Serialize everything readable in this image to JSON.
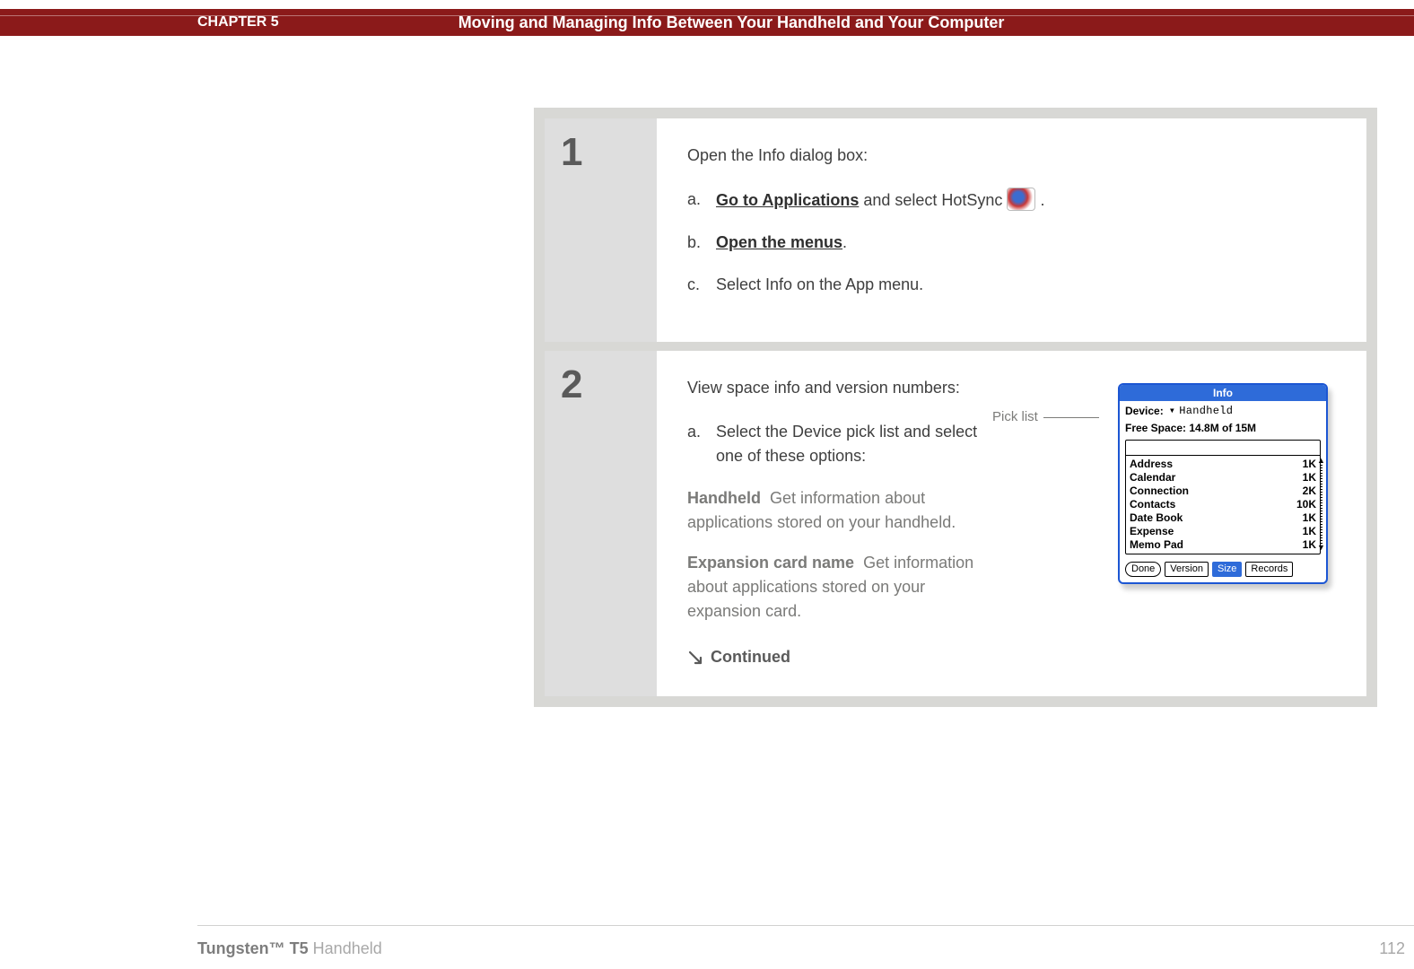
{
  "header": {
    "chapter": "CHAPTER 5",
    "title": "Moving and Managing Info Between Your Handheld and Your Computer"
  },
  "steps": {
    "one": {
      "num": "1",
      "intro": "Open the Info dialog box:",
      "a_link": "Go to Applications",
      "a_rest": " and select HotSync ",
      "a_period": ".",
      "b_link": "Open the menus",
      "b_period": ".",
      "c_text": "Select Info on the App menu."
    },
    "two": {
      "num": "2",
      "intro": "View space info and version numbers:",
      "a_text": "Select the Device pick list and select one of these options:",
      "opt1_name": "Handheld",
      "opt1_desc": "Get information about applications stored on your handheld.",
      "opt2_name": "Expansion card name",
      "opt2_desc": "Get information about applications stored on your expansion card.",
      "continued": "Continued"
    }
  },
  "callout": {
    "picklist": "Pick list"
  },
  "info_dialog": {
    "title": "Info",
    "device_label": "Device:",
    "device_value": "Handheld",
    "free_space": "Free Space: 14.8M of 15M",
    "items": [
      {
        "name": "Address",
        "size": "1K"
      },
      {
        "name": "Calendar",
        "size": "1K"
      },
      {
        "name": "Connection",
        "size": "2K"
      },
      {
        "name": "Contacts",
        "size": "10K"
      },
      {
        "name": "Date Book",
        "size": "1K"
      },
      {
        "name": "Expense",
        "size": "1K"
      },
      {
        "name": "Memo Pad",
        "size": "1K"
      }
    ],
    "buttons": {
      "done": "Done",
      "version": "Version",
      "size": "Size",
      "records": "Records"
    }
  },
  "footer": {
    "product_bold": "Tungsten™ T5",
    "product_rest": " Handheld",
    "page": "112"
  }
}
